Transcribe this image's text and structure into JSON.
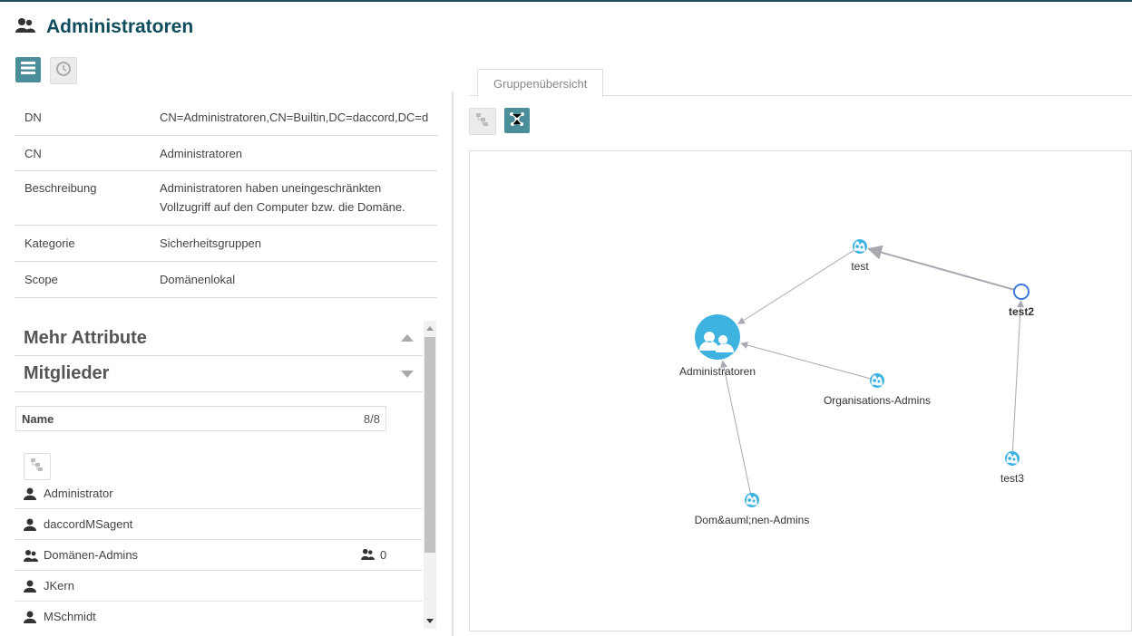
{
  "header": {
    "title": "Administratoren"
  },
  "attributes": [
    {
      "key": "DN",
      "value": "CN=Administratoren,CN=Builtin,DC=daccord,DC=d"
    },
    {
      "key": "CN",
      "value": "Administratoren"
    },
    {
      "key": "Beschreibung",
      "value": "Administratoren haben uneingeschränkten Vollzugriff auf den Computer bzw. die Domäne."
    },
    {
      "key": "Kategorie",
      "value": "Sicherheitsgruppen"
    },
    {
      "key": "Scope",
      "value": "Domänenlokal"
    }
  ],
  "sections": {
    "more_attributes": "Mehr Attribute",
    "members": "Mitglieder"
  },
  "members_header": {
    "name": "Name",
    "count": "8/8"
  },
  "members": [
    {
      "name": "Administrator",
      "type": "user"
    },
    {
      "name": "daccordMSagent",
      "type": "user"
    },
    {
      "name": "Domänen-Admins",
      "type": "group",
      "count": "0"
    },
    {
      "name": "JKern",
      "type": "user"
    },
    {
      "name": "MSchmidt",
      "type": "user"
    }
  ],
  "tab": {
    "label": "Gruppenübersicht"
  },
  "graph": {
    "nodes": [
      {
        "id": "admins",
        "label": "Administratoren"
      },
      {
        "id": "test",
        "label": "test"
      },
      {
        "id": "test2",
        "label": "test2"
      },
      {
        "id": "orgadmins",
        "label": "Organisations-Admins"
      },
      {
        "id": "test3",
        "label": "test3"
      },
      {
        "id": "domadmins",
        "label": "Dom&auml;nen-Admins"
      }
    ],
    "edges": [
      {
        "from": "test",
        "to": "admins"
      },
      {
        "from": "test2",
        "to": "test"
      },
      {
        "from": "orgadmins",
        "to": "admins"
      },
      {
        "from": "domadmins",
        "to": "admins"
      },
      {
        "from": "test3",
        "to": "test2"
      }
    ]
  },
  "colors": {
    "accent": "#4b8d98",
    "title": "#0f4c5c",
    "node": "#3fb3e0"
  }
}
